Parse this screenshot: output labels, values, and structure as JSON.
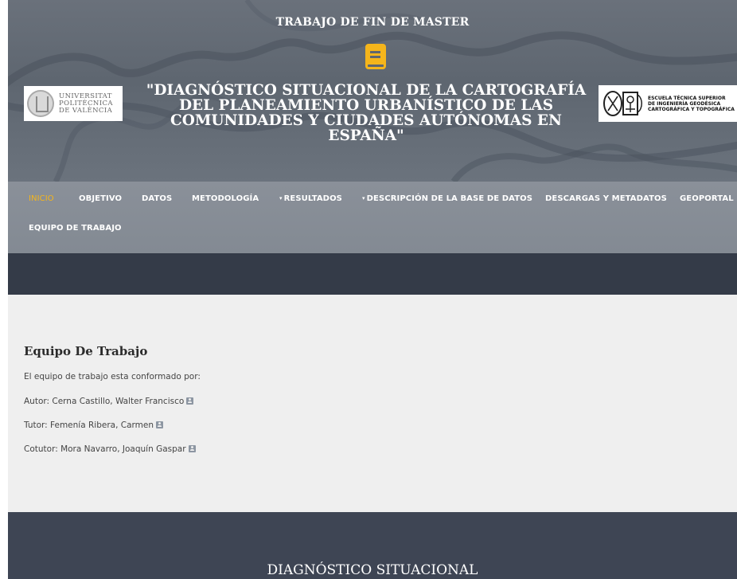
{
  "hero": {
    "kicker": "TRABAJO DE FIN DE MASTER",
    "title": "\"DIAGNÓSTICO SITUACIONAL DE LA CARTOGRAFÍA DEL PLANEAMIENTO URBANÍSTICO DE LAS COMUNIDADES Y CIUDADES AUTÓNOMAS EN ESPAÑA\"",
    "icon": "book-icon",
    "accent_color": "#f5b51b",
    "logo_left": {
      "lines": [
        "UNIVERSITAT",
        "POLITÈCNICA",
        "DE VALÈNCIA"
      ]
    },
    "logo_right": {
      "lines": [
        "ESCUELA TÉCNICA SUPERIOR",
        "DE INGENIERÍA GEODÉSICA",
        "CARTOGRÁFICA Y TOPOGRÁFICA"
      ]
    }
  },
  "nav": {
    "items": [
      {
        "label": "INICIO",
        "active": true
      },
      {
        "label": "OBJETIVO"
      },
      {
        "label": "DATOS"
      },
      {
        "label": "METODOLOGÍA"
      },
      {
        "label": "RESULTADOS",
        "dropdown": true
      },
      {
        "label": "DESCRIPCIÓN DE LA BASE DE DATOS",
        "dropdown": true
      },
      {
        "label": "DESCARGAS Y METADATOS"
      },
      {
        "label": "GEOPORTAL"
      },
      {
        "label": "EQUIPO DE TRABAJO"
      }
    ],
    "active_color": "#f5b51b"
  },
  "content": {
    "title": "Equipo De Trabajo",
    "intro": "El equipo de trabajo esta conformado por:",
    "members": [
      {
        "text": "Autor: Cerna Castillo, Walter Francisco",
        "icon": "contact-card-icon"
      },
      {
        "text": "Tutor: Femenía Ribera, Carmen",
        "icon": "contact-card-icon"
      },
      {
        "text": "Cotutor: Mora Navarro, Joaquín Gaspar",
        "icon": "contact-card-icon"
      }
    ]
  },
  "footer": {
    "title": "DIAGNÓSTICO SITUACIONAL"
  }
}
